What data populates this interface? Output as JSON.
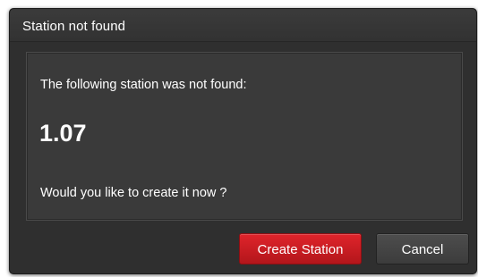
{
  "dialog": {
    "title": "Station not found",
    "message": "The following station was not found:",
    "station": "1.07",
    "question": "Would you like to create it now ?",
    "primary_button": "Create Station",
    "secondary_button": "Cancel"
  },
  "colors": {
    "dialog_background": "#2f2f2f",
    "content_background": "#3a3a3a",
    "primary_button": "#d01f25",
    "secondary_button": "#444444",
    "text": "#ffffff"
  }
}
